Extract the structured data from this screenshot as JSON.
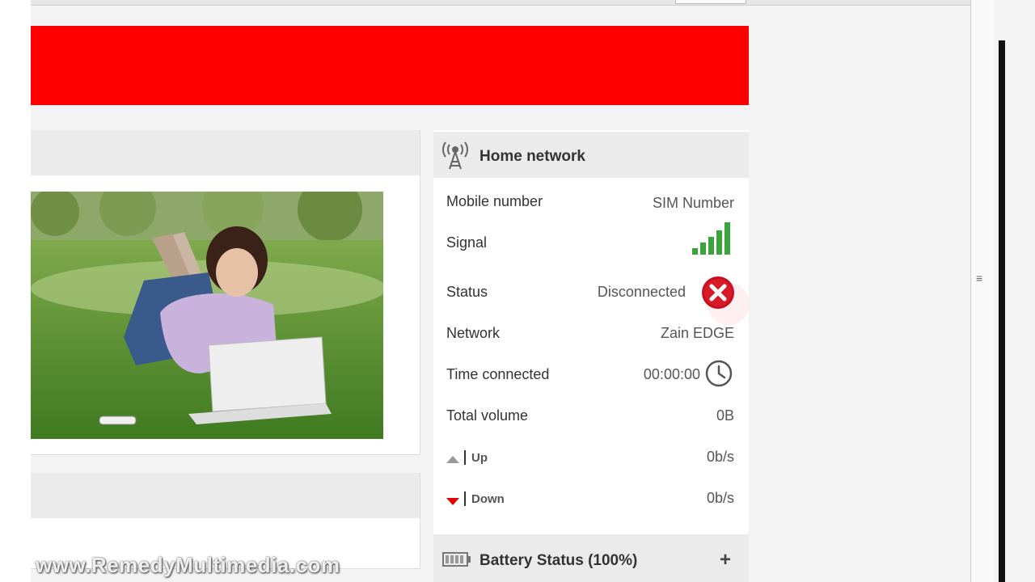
{
  "home_network": {
    "title": "Home network",
    "rows": {
      "mobile_number": {
        "label": "Mobile number",
        "value": "SIM Number"
      },
      "signal": {
        "label": "Signal",
        "bars": 5
      },
      "status": {
        "label": "Status",
        "value": "Disconnected"
      },
      "network": {
        "label": "Network",
        "value": "Zain EDGE"
      },
      "time_connected": {
        "label": "Time connected",
        "value": "00:00:00"
      },
      "total_volume": {
        "label": "Total volume",
        "value": "0B"
      },
      "up": {
        "label": "Up",
        "value": "0b/s"
      },
      "down": {
        "label": "Down",
        "value": "0b/s"
      }
    }
  },
  "battery": {
    "title": "Battery Status (100%)",
    "expand_glyph": "+"
  },
  "watermark": "www.RemedyMultimedia.com",
  "colors": {
    "brand": "#fe0000",
    "signal": "#3aa53a",
    "status_error": "#c8101e",
    "down_arrow": "#e00000",
    "up_arrow": "#999999"
  },
  "icons": [
    "antenna-icon",
    "signal-bars-icon",
    "error-x-icon",
    "clock-icon",
    "up-arrow-icon",
    "down-arrow-icon",
    "battery-icon",
    "plus-icon"
  ]
}
